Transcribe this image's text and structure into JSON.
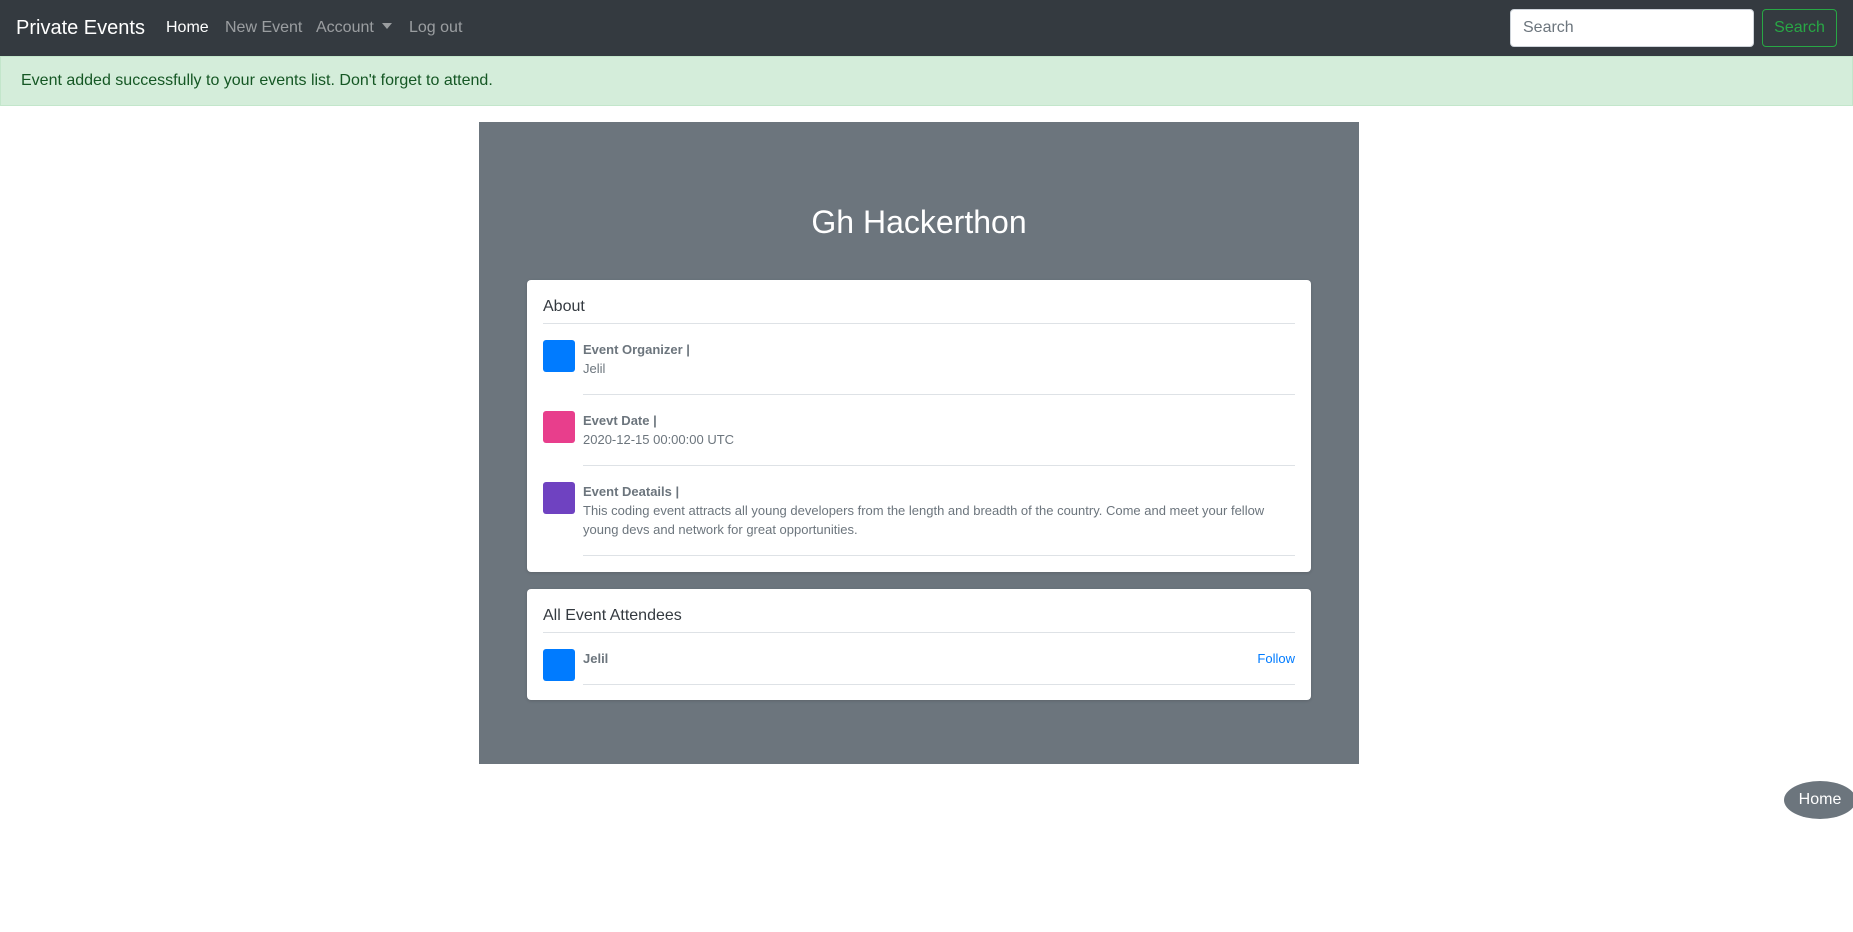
{
  "navbar": {
    "brand": "Private Events",
    "links": [
      {
        "label": "Home"
      },
      {
        "label": "New Event"
      },
      {
        "label": "Account"
      },
      {
        "label": "Log out"
      }
    ],
    "search": {
      "placeholder": "Search",
      "value": "",
      "button": "Search"
    }
  },
  "alert": {
    "message": "Event added successfully to your events list. Don't forget to attend."
  },
  "event": {
    "title": "Gh Hackerthon",
    "about": {
      "heading": "About",
      "items": [
        {
          "label": "Event Organizer |",
          "value": "Jelil",
          "color": "#007bff"
        },
        {
          "label": "Evevt Date |",
          "value": "2020-12-15 00:00:00 UTC",
          "color": "#e83e8c"
        },
        {
          "label": "Event Deatails |",
          "value": "This coding event attracts all young developers from the length and breadth of the country. Come and meet your fellow young devs and network for great opportunities.",
          "color": "#6f42c1"
        }
      ]
    },
    "attendees": {
      "heading": "All Event Attendees",
      "items": [
        {
          "name": "Jelil",
          "action": "Follow",
          "color": "#007bff"
        }
      ]
    }
  },
  "floating": {
    "home": "Home"
  }
}
